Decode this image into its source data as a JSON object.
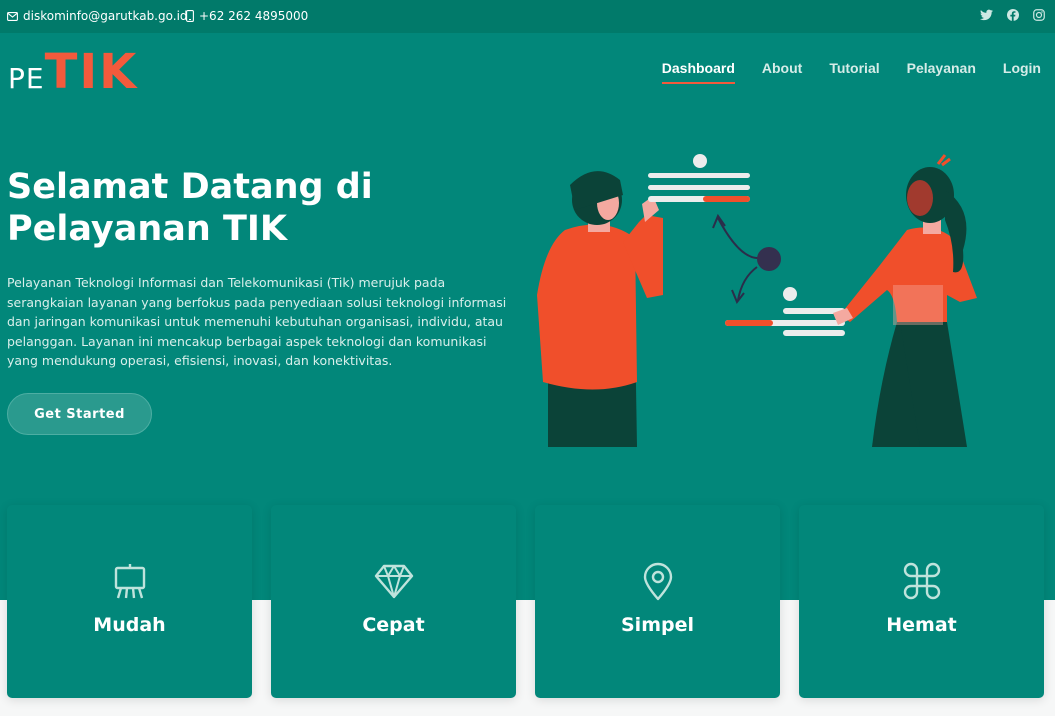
{
  "topbar": {
    "email": "diskominfo@garutkab.go.id",
    "phone": "+62 262 4895000",
    "socials": [
      "twitter-icon",
      "facebook-icon",
      "instagram-icon"
    ]
  },
  "logo": {
    "prefix": "PE",
    "main": "TIK"
  },
  "nav": {
    "items": [
      {
        "label": "Dashboard",
        "active": true
      },
      {
        "label": "About"
      },
      {
        "label": "Tutorial"
      },
      {
        "label": "Pelayanan"
      },
      {
        "label": "Login"
      }
    ]
  },
  "hero": {
    "title_line1": "Selamat Datang di",
    "title_line2": "Pelayanan TIK",
    "description": "Pelayanan Teknologi Informasi dan Telekomunikasi (Tik) merujuk pada serangkaian layanan yang berfokus pada penyediaan solusi teknologi informasi dan jaringan komunikasi untuk memenuhi kebutuhan organisasi, individu, atau pelanggan. Layanan ini mencakup berbagai aspek teknologi dan komunikasi yang mendukung operasi, efisiensi, inovasi, dan konektivitas.",
    "cta": "Get Started"
  },
  "features": [
    {
      "title": "Mudah",
      "icon": "easel-icon"
    },
    {
      "title": "Cepat",
      "icon": "gem-icon"
    },
    {
      "title": "Simpel",
      "icon": "location-pin-icon"
    },
    {
      "title": "Hemat",
      "icon": "command-icon"
    }
  ],
  "colors": {
    "primary": "#02877a",
    "topbar": "#017a6a",
    "accent": "#f35a3c",
    "background": "#f6f7f7"
  }
}
